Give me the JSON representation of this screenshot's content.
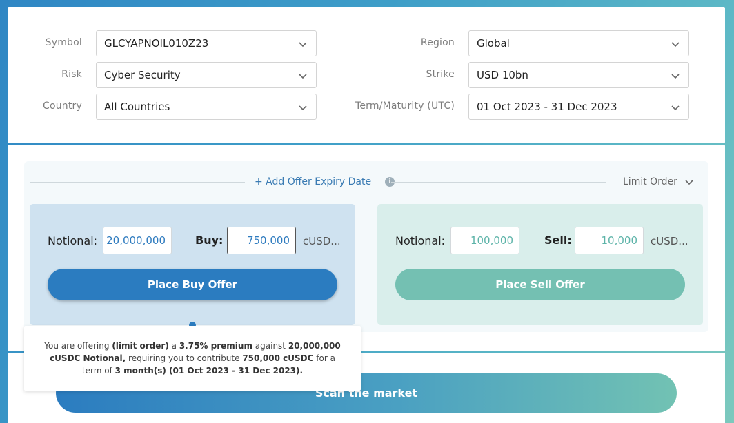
{
  "filters": {
    "symbol_label": "Symbol",
    "symbol_value": "GLCYAPNOIL010Z23",
    "risk_label": "Risk",
    "risk_value": "Cyber Security",
    "country_label": "Country",
    "country_value": "All Countries",
    "region_label": "Region",
    "region_value": "Global",
    "strike_label": "Strike",
    "strike_value": "USD 10bn",
    "term_label": "Term/Maturity (UTC)",
    "term_value": "01 Oct 2023 - 31 Dec 2023"
  },
  "offer": {
    "add_expiry_label": "+ Add Offer Expiry Date",
    "info_icon": "info-icon",
    "order_type": "Limit Order",
    "buy": {
      "notional_label": "Notional:",
      "notional_value": "20,000,000",
      "amount_label": "Buy:",
      "amount_value": "750,000",
      "currency": "cUSD...",
      "button_label": "Place Buy Offer"
    },
    "sell": {
      "notional_label": "Notional:",
      "notional_value": "100,000",
      "amount_label": "Sell:",
      "amount_value": "10,000",
      "currency": "cUSD...",
      "button_label": "Place Sell Offer"
    }
  },
  "tooltip": {
    "t1": "You are offering",
    "b1": "(limit order)",
    "t2": "a",
    "b2": "3.75% premium",
    "t3": "against",
    "b3": "20,000,000 cUSDC Notional,",
    "t4": "requiring you to contribute",
    "b4": "750,000 cUSDC",
    "t5": "for a term of",
    "b5": "3 month(s) (01 Oct 2023 - 31 Dec 2023)."
  },
  "scan_label": "Scan the market",
  "colors": {
    "primary": "#2b7cc0",
    "teal": "#74c0b2",
    "buy_panel": "#cfe2f0",
    "sell_panel": "#d9eeeb"
  }
}
